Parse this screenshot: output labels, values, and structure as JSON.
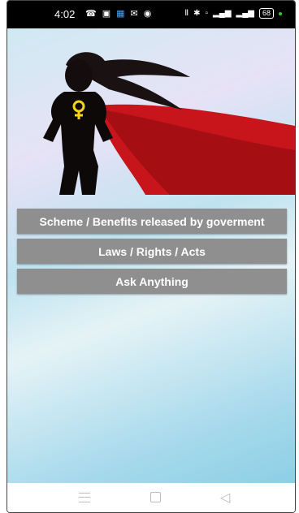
{
  "status_bar": {
    "time": "4:02",
    "left_icons": [
      "phone-icon",
      "camera-icon",
      "app-icon",
      "mail-icon",
      "chat-icon"
    ],
    "right_icons": [
      "vibrate-icon",
      "bluetooth-icon",
      "volte-icon",
      "signal-icon",
      "signal-icon-2"
    ],
    "battery": "68"
  },
  "buttons": {
    "schemes": "Scheme / Benefits released by goverment",
    "laws": "Laws / Rights / Acts",
    "ask": "Ask Anything"
  },
  "colors": {
    "button_bg": "#8f8f8f",
    "cape_red": "#c8141b",
    "emblem_yellow": "#f5d21b"
  }
}
